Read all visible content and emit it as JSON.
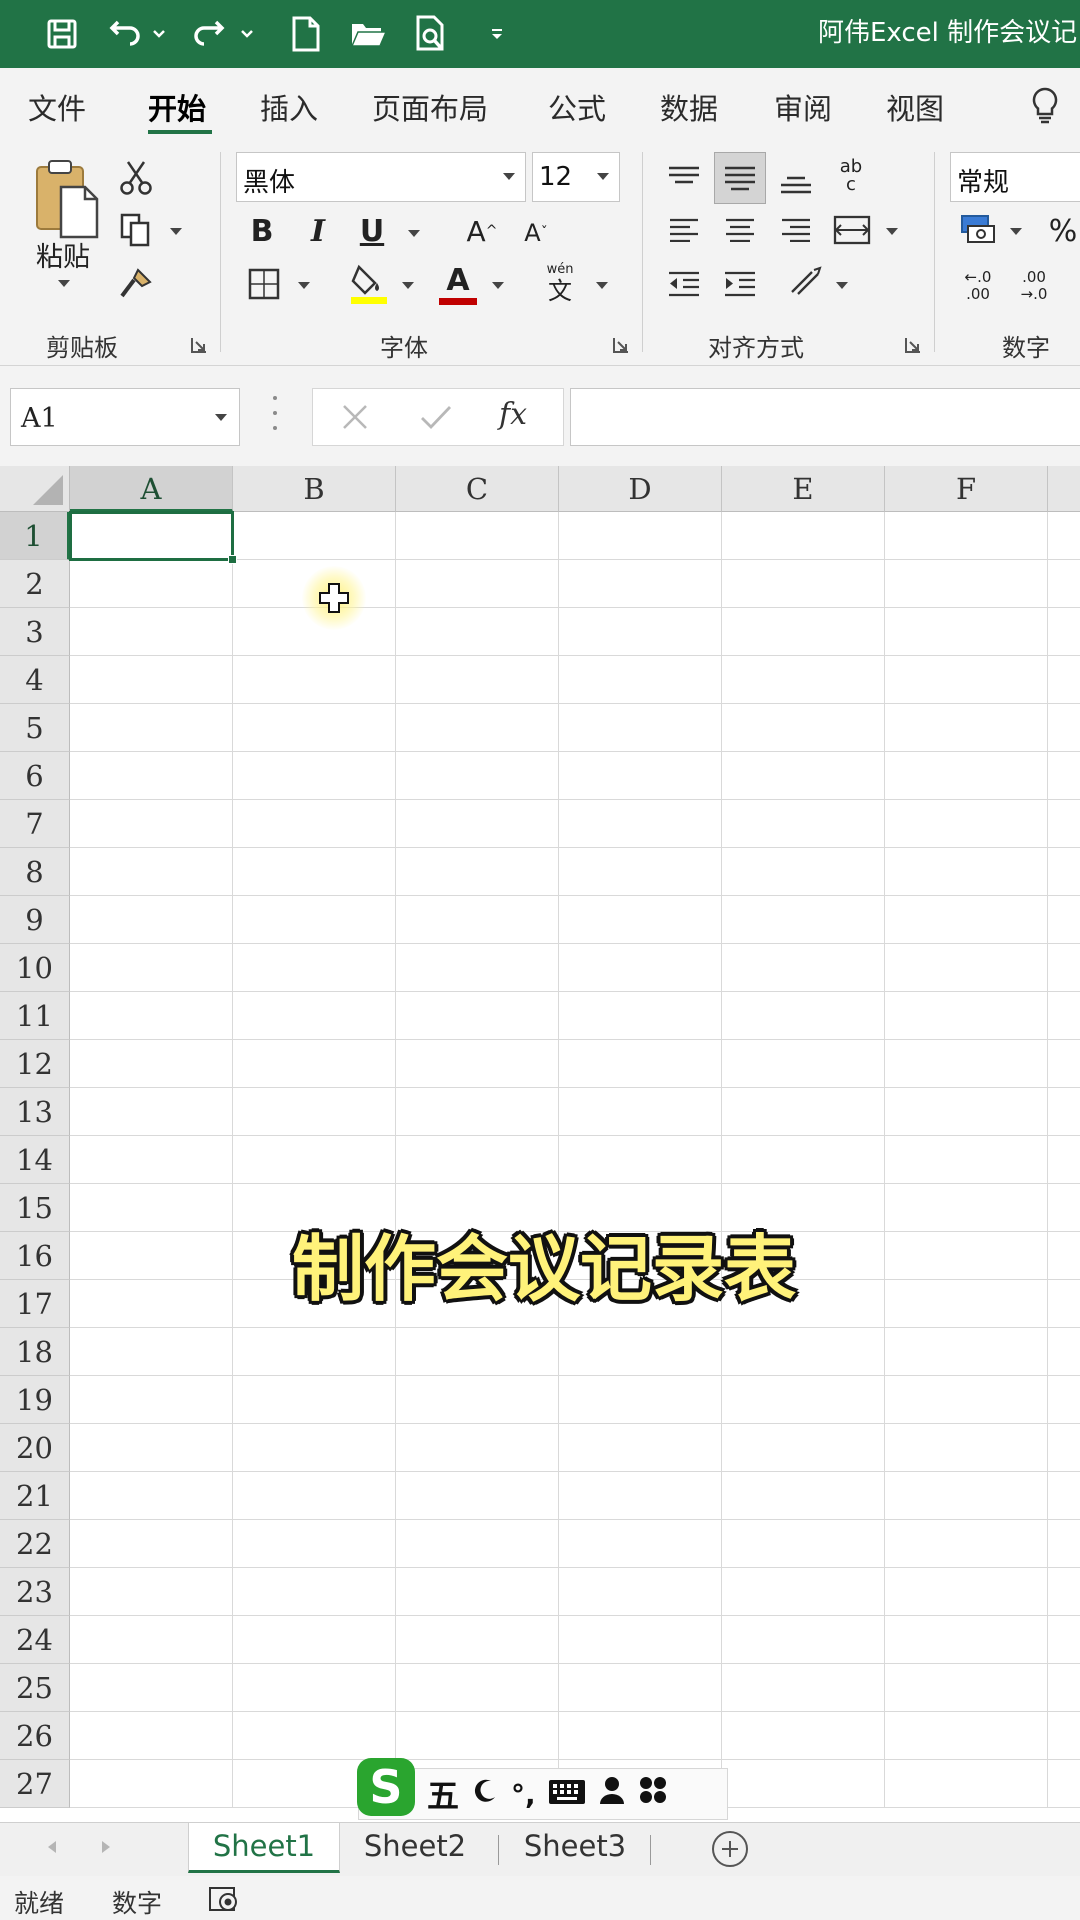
{
  "window": {
    "title": "阿伟Excel 制作会议记"
  },
  "quick_access": [
    "save-icon",
    "undo-icon",
    "redo-icon",
    "new-file-icon",
    "open-folder-icon",
    "print-preview-icon",
    "customize-icon"
  ],
  "ribbon_tabs": [
    {
      "label": "文件",
      "active": false
    },
    {
      "label": "开始",
      "active": true
    },
    {
      "label": "插入",
      "active": false
    },
    {
      "label": "页面布局",
      "active": false
    },
    {
      "label": "公式",
      "active": false
    },
    {
      "label": "数据",
      "active": false
    },
    {
      "label": "审阅",
      "active": false
    },
    {
      "label": "视图",
      "active": false
    }
  ],
  "clipboard": {
    "paste_label": "粘贴",
    "group_label": "剪贴板"
  },
  "font": {
    "name": "黑体",
    "size": "12",
    "group_label": "字体",
    "bold": "B",
    "italic": "I",
    "underline": "U",
    "grow": "A",
    "shrink": "A",
    "font_color_letter": "A",
    "fill_color": "#ffff00",
    "font_color": "#c00000",
    "phonetic_top": "wén",
    "phonetic_bottom": "文"
  },
  "alignment": {
    "group_label": "对齐方式",
    "wrap_top": "ab",
    "wrap_bottom": "c"
  },
  "number": {
    "format": "常规",
    "group_label": "数字",
    "percent": "%",
    "inc_decimal_top": "←.0",
    "inc_decimal_bottom": ".00",
    "dec_decimal_top": ".00",
    "dec_decimal_bottom": "→.0"
  },
  "formula_bar": {
    "name_box": "A1",
    "fx": "fx",
    "content": ""
  },
  "columns": [
    "A",
    "B",
    "C",
    "D",
    "E",
    "F"
  ],
  "rows": [
    "1",
    "2",
    "3",
    "4",
    "5",
    "6",
    "7",
    "8",
    "9",
    "10",
    "11",
    "12",
    "13",
    "14",
    "15",
    "16",
    "17",
    "18",
    "19",
    "20",
    "21",
    "22",
    "23",
    "24",
    "25",
    "26",
    "27"
  ],
  "selected_cell": "A1",
  "overlay_caption": "制作会议记录表",
  "ime_bar": {
    "logo": "S",
    "mode": "五",
    "punct": "°,",
    "items": [
      "moon-icon",
      "keyboard-icon",
      "user-icon",
      "grid-icon"
    ]
  },
  "sheets": [
    {
      "label": "Sheet1",
      "active": true
    },
    {
      "label": "Sheet2",
      "active": false
    },
    {
      "label": "Sheet3",
      "active": false
    }
  ],
  "status": {
    "ready": "就绪",
    "num_lock": "数字"
  },
  "colors": {
    "accent": "#217346",
    "title_bar": "#217346"
  }
}
